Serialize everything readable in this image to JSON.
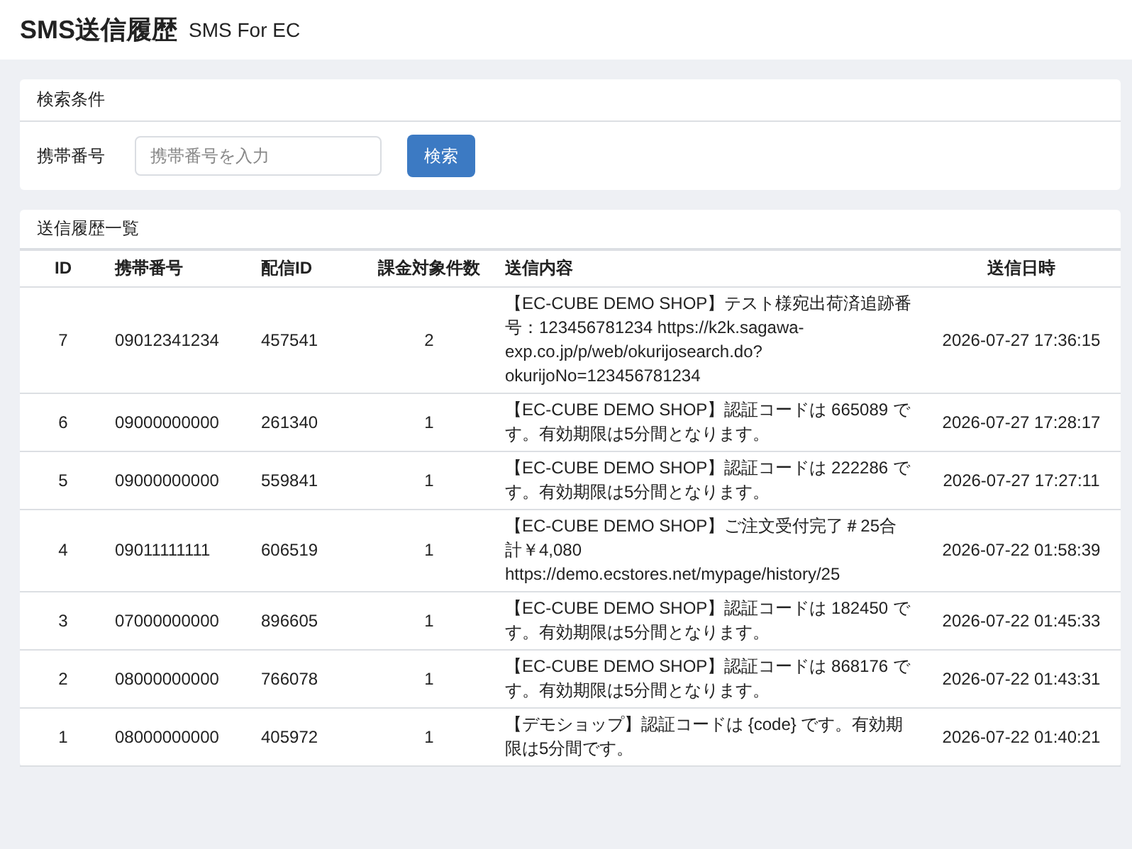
{
  "header": {
    "title": "SMS送信履歴",
    "subtitle": "SMS For EC"
  },
  "search_panel": {
    "title": "検索条件",
    "field_label": "携帯番号",
    "field": {
      "placeholder": "携帯番号を入力"
    },
    "button": "検索"
  },
  "history_panel": {
    "title": "送信履歴一覧",
    "table": {
      "columns": [
        "ID",
        "携帯番号",
        "配信ID",
        "課金対象件数",
        "送信内容",
        "送信日時"
      ],
      "rows": [
        [
          "7",
          "09012341234",
          "457541",
          "2",
          "【EC-CUBE DEMO SHOP】テスト様宛出荷済追跡番号：123456781234 https://k2k.sagawa-exp.co.jp/p/web/okurijosearch.do?okurijoNo=123456781234",
          "2026-07-27 17:36:15"
        ],
        [
          "6",
          "09000000000",
          "261340",
          "1",
          "【EC-CUBE DEMO SHOP】認証コードは 665089 です。有効期限は5分間となります。",
          "2026-07-27 17:28:17"
        ],
        [
          "5",
          "09000000000",
          "559841",
          "1",
          "【EC-CUBE DEMO SHOP】認証コードは 222286 です。有効期限は5分間となります。",
          "2026-07-27 17:27:11"
        ],
        [
          "4",
          "09011111111",
          "606519",
          "1",
          "【EC-CUBE DEMO SHOP】ご注文受付完了＃25合計￥4,080 https://demo.ecstores.net/mypage/history/25",
          "2026-07-22 01:58:39"
        ],
        [
          "3",
          "07000000000",
          "896605",
          "1",
          "【EC-CUBE DEMO SHOP】認証コードは 182450 です。有効期限は5分間となります。",
          "2026-07-22 01:45:33"
        ],
        [
          "2",
          "08000000000",
          "766078",
          "1",
          "【EC-CUBE DEMO SHOP】認証コードは 868176 です。有効期限は5分間となります。",
          "2026-07-22 01:43:31"
        ],
        [
          "1",
          "08000000000",
          "405972",
          "1",
          "【デモショップ】認証コードは {code} です。有効期限は5分間です。",
          "2026-07-22 01:40:21"
        ]
      ]
    }
  }
}
